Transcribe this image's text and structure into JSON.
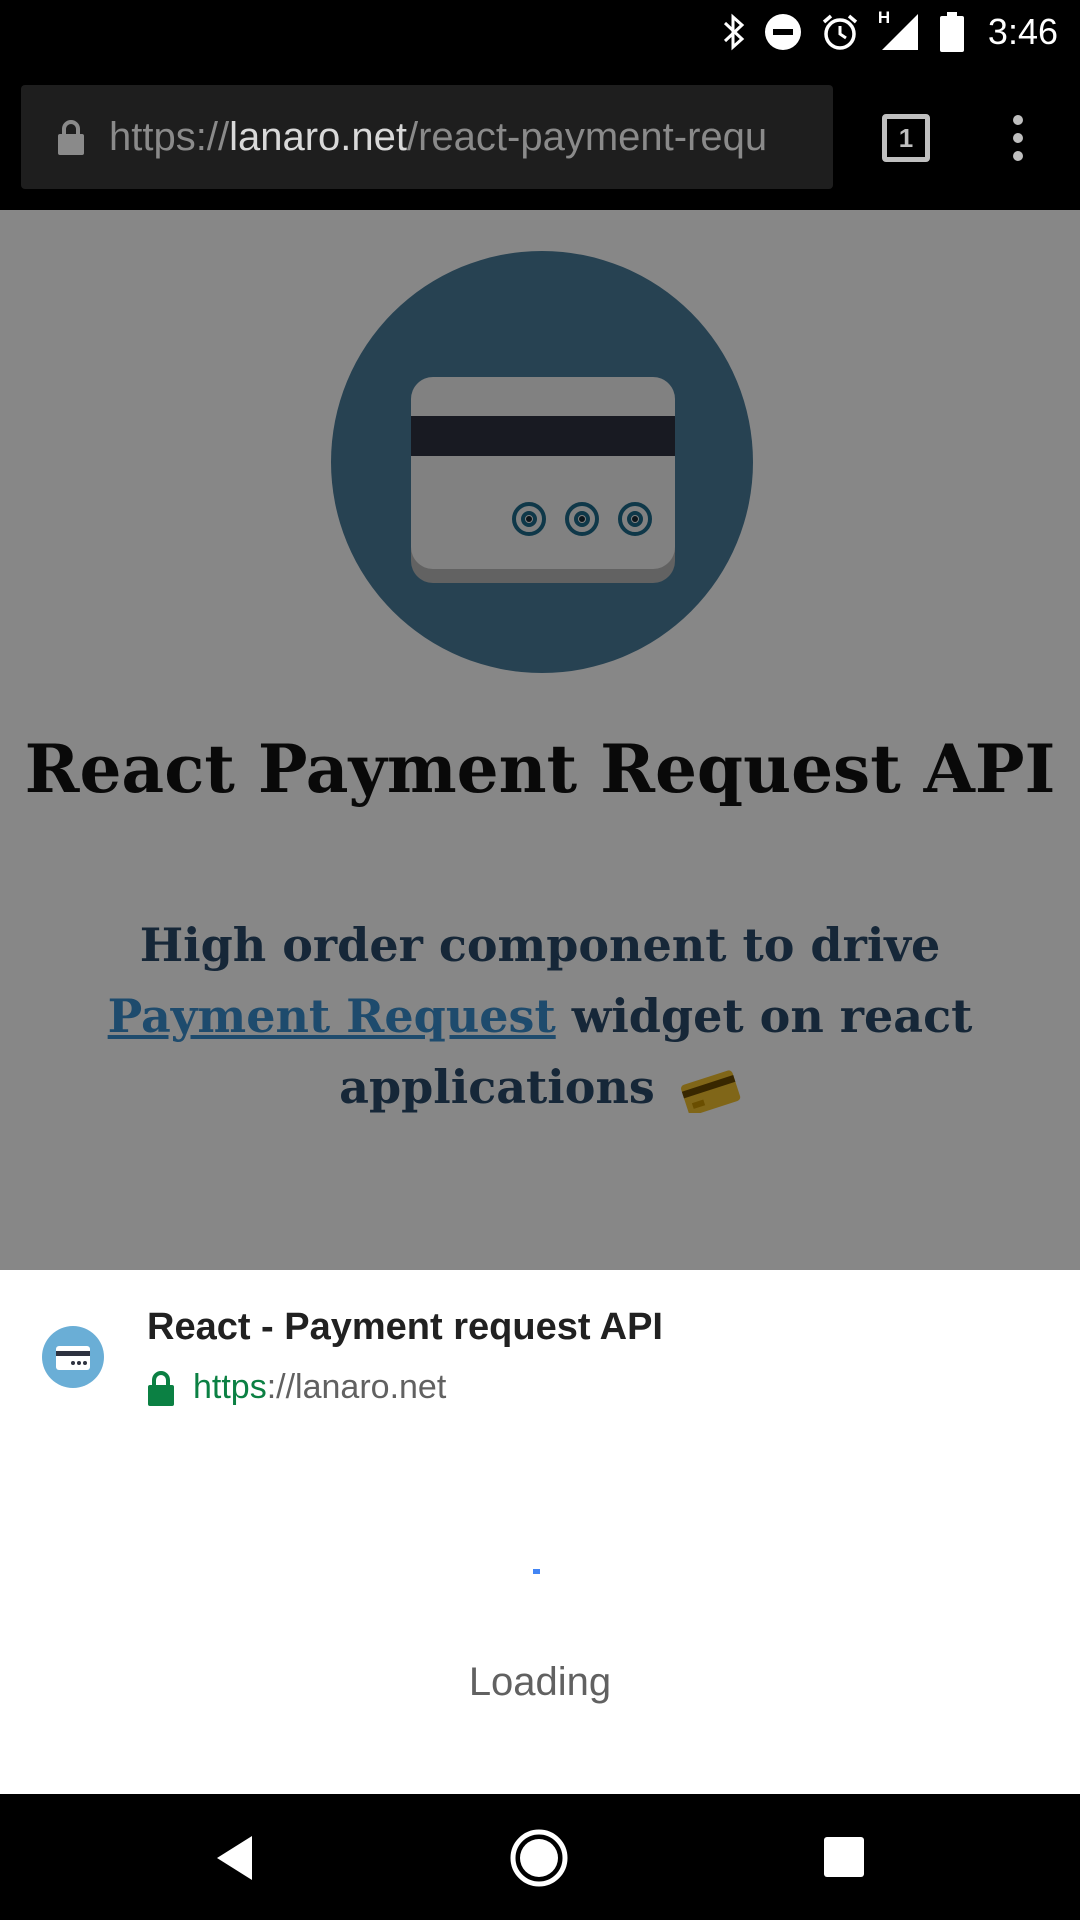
{
  "status_bar": {
    "time": "3:46",
    "network_type": "H",
    "icons": [
      "bluetooth-icon",
      "do-not-disturb-icon",
      "alarm-icon",
      "cellular-signal-icon",
      "battery-icon"
    ]
  },
  "browser": {
    "url_scheme": "https://",
    "url_host": "lanaro.net",
    "url_path": "/react-payment-requ",
    "tab_count": "1"
  },
  "page": {
    "title": "React Payment Request API",
    "subtitle_before": "High order component to drive ",
    "subtitle_link": "Payment Request",
    "subtitle_after": " widget on react applications",
    "colors": {
      "logo_circle": "#4a7d9b",
      "dark_band": "#2e3240"
    }
  },
  "payment_sheet": {
    "title": "React - Payment request API",
    "origin_scheme": "https",
    "origin_rest": "://lanaro.net",
    "loading_text": "Loading"
  },
  "nav_bar": {
    "icons": [
      "back-icon",
      "home-icon",
      "recents-icon"
    ]
  }
}
